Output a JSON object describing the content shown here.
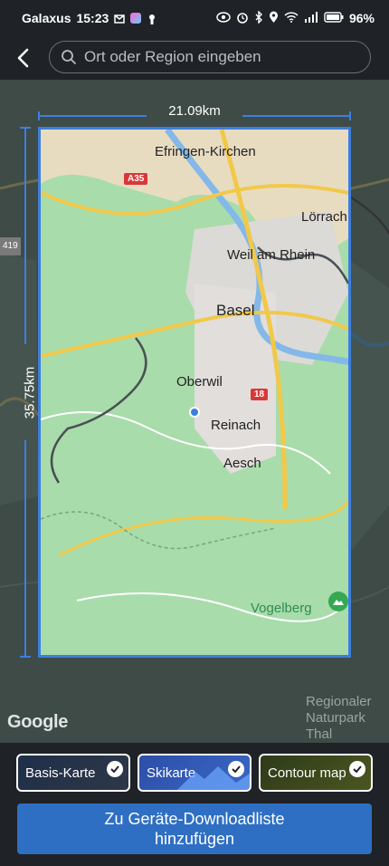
{
  "status": {
    "carrier": "Galaxus",
    "time": "15:23",
    "battery": "96%"
  },
  "search": {
    "placeholder": "Ort oder Region eingeben"
  },
  "map": {
    "width_label": "21.09km",
    "height_label": "35.75km",
    "google_logo": "Google",
    "places": {
      "efringen_kirchen": "Efringen-Kirchen",
      "loerrach": "Lörrach",
      "weil_am_rhein": "Weil am Rhein",
      "basel": "Basel",
      "oberwil": "Oberwil",
      "reinach": "Reinach",
      "aesch": "Aesch",
      "vogelberg": "Vogelberg",
      "naturpark": "Regionaler Naturpark Thal"
    },
    "shields": {
      "a35": "A35",
      "route18": "18",
      "route419": "419"
    }
  },
  "map_options": [
    {
      "label": "Basis-Karte",
      "selected": true
    },
    {
      "label": "Skikarte",
      "selected": true
    },
    {
      "label": "Contour map",
      "selected": true
    }
  ],
  "cta": {
    "line1": "Zu Geräte-Downloadliste",
    "line2": "hinzufügen"
  },
  "colors": {
    "accent": "#3c7ee0",
    "button": "#2e6fc3",
    "background": "#1f2226"
  }
}
